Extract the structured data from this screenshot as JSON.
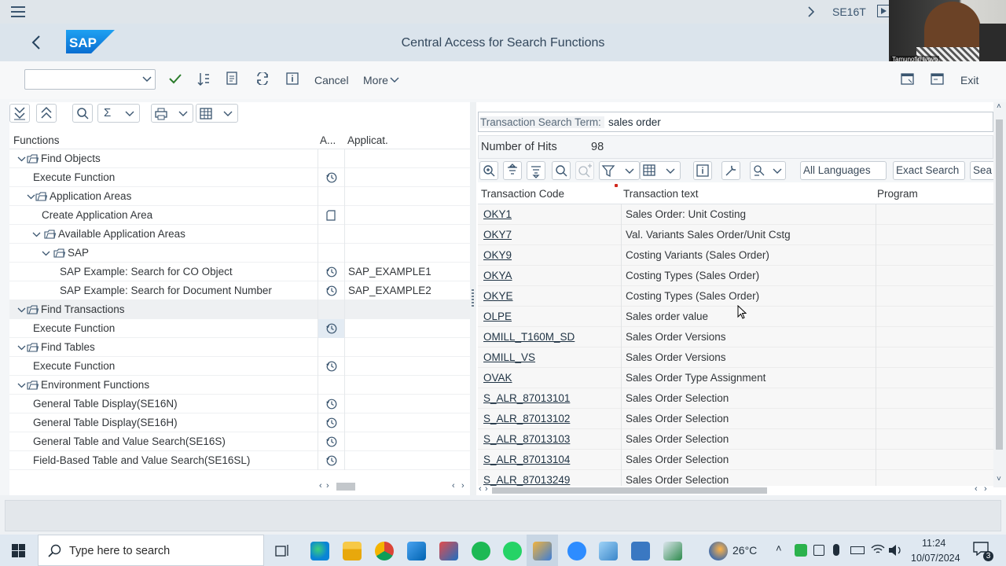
{
  "window": {
    "tcode": "SE16T",
    "title": "Central Access for Search Functions",
    "webcam_name": "Tamunofiri Iyoyo"
  },
  "toolbar": {
    "cancel": "Cancel",
    "more": "More",
    "exit": "Exit"
  },
  "tree": {
    "headers": {
      "functions": "Functions",
      "a": "A...",
      "application": "Applicat."
    },
    "rows": [
      {
        "label": "Find Objects",
        "app": ""
      },
      {
        "label": "Execute Function",
        "app": ""
      },
      {
        "label": "Application Areas",
        "app": ""
      },
      {
        "label": "Create Application Area",
        "app": ""
      },
      {
        "label": "Available Application Areas",
        "app": ""
      },
      {
        "label": "SAP",
        "app": ""
      },
      {
        "label": "SAP Example: Search for CO Object",
        "app": "SAP_EXAMPLE1"
      },
      {
        "label": "SAP Example: Search for Document Number",
        "app": "SAP_EXAMPLE2"
      },
      {
        "label": "Find Transactions",
        "app": ""
      },
      {
        "label": "Execute Function",
        "app": ""
      },
      {
        "label": "Find Tables",
        "app": ""
      },
      {
        "label": "Execute Function",
        "app": ""
      },
      {
        "label": "Environment Functions",
        "app": ""
      },
      {
        "label": "General Table Display(SE16N)",
        "app": ""
      },
      {
        "label": "General Table Display(SE16H)",
        "app": ""
      },
      {
        "label": "General Table and Value Search(SE16S)",
        "app": ""
      },
      {
        "label": "Field-Based Table and Value Search(SE16SL)",
        "app": ""
      }
    ]
  },
  "search": {
    "label": "Transaction Search Term:",
    "value": "sales order",
    "hits_label": "Number of Hits",
    "hits": "98"
  },
  "results": {
    "buttons": {
      "all_languages": "All Languages",
      "exact_search": "Exact Search",
      "search_cut": "Sea"
    },
    "headers": {
      "code": "Transaction Code",
      "text": "Transaction text",
      "program": "Program"
    },
    "rows": [
      {
        "code": "OKY1",
        "text": "Sales Order: Unit Costing"
      },
      {
        "code": "OKY7",
        "text": "Val. Variants Sales Order/Unit Cstg"
      },
      {
        "code": "OKY9",
        "text": "Costing Variants (Sales Order)"
      },
      {
        "code": "OKYA",
        "text": "Costing Types (Sales Order)"
      },
      {
        "code": "OKYE",
        "text": "Costing Types (Sales Order)"
      },
      {
        "code": "OLPE",
        "text": "Sales order value"
      },
      {
        "code": "OMILL_T160M_SD",
        "text": "Sales Order Versions"
      },
      {
        "code": "OMILL_VS",
        "text": "Sales Order Versions"
      },
      {
        "code": "OVAK",
        "text": "Sales Order Type Assignment"
      },
      {
        "code": "S_ALR_87013101",
        "text": "Sales Order Selection"
      },
      {
        "code": "S_ALR_87013102",
        "text": "Sales Order Selection"
      },
      {
        "code": "S_ALR_87013103",
        "text": "Sales Order Selection"
      },
      {
        "code": "S_ALR_87013104",
        "text": "Sales Order Selection"
      },
      {
        "code": "S_ALR_87013249",
        "text": "Sales Order Selection"
      }
    ]
  },
  "taskbar": {
    "search_placeholder": "Type here to search",
    "temperature": "26°C",
    "time": "11:24",
    "date": "10/07/2024",
    "notifications": "3"
  },
  "colors": {
    "sap_blue": "#0a6ed1",
    "shell": "#dbe4ec",
    "link": "#1f3344",
    "checkmark": "#2b7c2b"
  }
}
